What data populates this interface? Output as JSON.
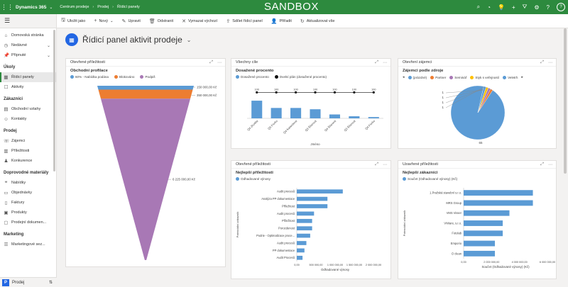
{
  "top": {
    "brand": "Dynamics 365",
    "area": "Centrum prodeje",
    "crumbs": [
      "Prodej",
      "Řídicí panely"
    ],
    "sandbox": "SANDBOX",
    "avatar_initial": "?"
  },
  "commands": [
    {
      "icon": "save-icon",
      "glyph": "🖫",
      "label": "Uložit jako",
      "chev": ""
    },
    {
      "icon": "plus-icon",
      "glyph": "+",
      "label": "Nový",
      "chev": "⌄"
    },
    {
      "icon": "pencil-icon",
      "glyph": "✎",
      "label": "Upravit",
      "chev": ""
    },
    {
      "icon": "trash-icon",
      "glyph": "🗑",
      "label": "Odstranit",
      "chev": ""
    },
    {
      "icon": "close-icon",
      "glyph": "✕",
      "label": "Vymazat výchozí",
      "chev": ""
    },
    {
      "icon": "share-icon",
      "glyph": "⇪",
      "label": "Sdílet řídicí panel",
      "chev": ""
    },
    {
      "icon": "assign-icon",
      "glyph": "👤",
      "label": "Přiřadit",
      "chev": ""
    },
    {
      "icon": "refresh-icon",
      "glyph": "↻",
      "label": "Aktualizovat vše",
      "chev": ""
    }
  ],
  "sidebar": {
    "top_items": [
      {
        "name": "home",
        "glyph": "⌂",
        "label": "Domovská stránka",
        "exp": ""
      },
      {
        "name": "recent",
        "glyph": "◷",
        "label": "Nedávné",
        "exp": "⌄"
      },
      {
        "name": "pinned",
        "glyph": "📌",
        "label": "Připnuté",
        "exp": "⌄"
      }
    ],
    "groups": [
      {
        "name": "ukoly",
        "title": "Úkoly",
        "items": [
          {
            "name": "dashboards",
            "glyph": "▦",
            "label": "Řídicí panely",
            "active": true
          },
          {
            "name": "activities",
            "glyph": "☐",
            "label": "Aktivity",
            "active": false
          }
        ]
      },
      {
        "name": "zakaznici",
        "title": "Zákazníci",
        "items": [
          {
            "name": "accounts",
            "glyph": "▤",
            "label": "Obchodní vztahy",
            "active": false
          },
          {
            "name": "contacts",
            "glyph": "☺",
            "label": "Kontakty",
            "active": false
          }
        ]
      },
      {
        "name": "prodej",
        "title": "Prodej",
        "items": [
          {
            "name": "leads",
            "glyph": "☏",
            "label": "Zájemci",
            "active": false
          },
          {
            "name": "opportunities",
            "glyph": "▥",
            "label": "Příležitosti",
            "active": false
          },
          {
            "name": "competitors",
            "glyph": "♟",
            "label": "Konkurence",
            "active": false
          }
        ]
      },
      {
        "name": "doprovodne",
        "title": "Doprovodné materiály",
        "items": [
          {
            "name": "quotes",
            "glyph": "❝",
            "label": "Nabídky",
            "active": false
          },
          {
            "name": "orders",
            "glyph": "▭",
            "label": "Objednávky",
            "active": false
          },
          {
            "name": "invoices",
            "glyph": "▯",
            "label": "Faktury",
            "active": false
          },
          {
            "name": "products",
            "glyph": "▣",
            "label": "Produkty",
            "active": false
          },
          {
            "name": "salesdocs",
            "glyph": "▢",
            "label": "Prodejní dokumen...",
            "active": false
          }
        ]
      },
      {
        "name": "marketing",
        "title": "Marketing",
        "items": [
          {
            "name": "marketinglists",
            "glyph": "☰",
            "label": "Marketingové sez...",
            "active": false
          }
        ]
      }
    ],
    "area_switcher": {
      "letter": "P",
      "label": "Prodej",
      "chev": "⇅"
    }
  },
  "page": {
    "title": "Řídicí panel aktivit prodeje"
  },
  "panels": {
    "p1": {
      "header": "Otevřené příležitosti",
      "title": "Obchodní profilace",
      "legend": [
        {
          "label": "60% - Nabídka podána",
          "color": "#5b9bd5"
        },
        {
          "label": "Blokováno",
          "color": "#ed7d31"
        },
        {
          "label": "Podpiš",
          "color": "#a878b5"
        }
      ]
    },
    "p2": {
      "header": "Všechny cíle",
      "title": "Dosažené procento",
      "legend": [
        {
          "label": "Dosažené procento",
          "color": "#5b9bd5"
        },
        {
          "label": "Dvelsí plán (dosažené procento)",
          "color": "#111111"
        }
      ]
    },
    "p3": {
      "header": "Otevření zájemci",
      "title": "Zájemci podle zdroje",
      "legend": [
        {
          "label": "(prázdné)",
          "color": "#5b9bd5"
        },
        {
          "label": "Partner",
          "color": "#ed7d31"
        },
        {
          "label": "Seminář",
          "color": "#a878b5"
        },
        {
          "label": "Styk s veřejností",
          "color": "#ffc000"
        },
        {
          "label": "Veletrh",
          "color": "#5b9bd5"
        }
      ]
    },
    "p4": {
      "header": "Otevřené příležitosti",
      "title": "Nejlepší příležitosti",
      "legend": [
        {
          "label": "Odhadované výnosy",
          "color": "#5b9bd5"
        }
      ]
    },
    "p5": {
      "header": "Uzavřené příležitosti",
      "title": "Nejlepší zákazníci",
      "legend": [
        {
          "label": "Součet (Odhadované výnosy) (Kč)",
          "color": "#5b9bd5"
        }
      ]
    }
  },
  "chart_data": [
    {
      "type": "funnel",
      "title": "Obchodní profilace",
      "categories": [
        "60% - Nabídka podána",
        "Blokováno",
        "Podpiš"
      ],
      "values": [
        150000,
        350000,
        6225000
      ],
      "labels": [
        "150 000,00 Kč",
        "350 000,00 Kč",
        "6 225 000,00 Kč"
      ],
      "colors": [
        "#5b9bd5",
        "#ed7d31",
        "#a878b5"
      ]
    },
    {
      "type": "bar",
      "title": "Dosažené procento",
      "xlabel": "Jméno",
      "categories": [
        "Q4 Zhodila",
        "Q3 Fiorko",
        "Q4 Kalandova",
        "Q3 Šilarová",
        "Q4 Šilarová",
        "Q3 Šilarová",
        "Q4 Fiorko"
      ],
      "series": [
        {
          "name": "Dosažené procento",
          "type": "bar",
          "values": [
            68,
            40,
            40,
            35,
            15,
            8,
            5
          ],
          "color": "#5b9bd5"
        },
        {
          "name": "Dvelsí plán (dosažené procento)",
          "type": "line",
          "values": [
            100,
            100,
            100,
            100,
            100,
            100,
            100
          ],
          "color": "#111111"
        }
      ],
      "point_labels": [
        "100",
        "100",
        "100",
        "100",
        "100",
        "100",
        "100"
      ],
      "ylim": [
        0,
        120
      ]
    },
    {
      "type": "pie",
      "title": "Zájemci podle zdroje",
      "categories": [
        "(prázdné)",
        "Partner",
        "Seminář",
        "Styk s veřejností",
        "Veletrh"
      ],
      "values": [
        65,
        1,
        1,
        1,
        1
      ],
      "colors": [
        "#5b9bd5",
        "#ed7d31",
        "#a878b5",
        "#ffc000",
        "#5b9bd5"
      ],
      "labels": [
        "65",
        "1",
        "1",
        "1",
        "1"
      ]
    },
    {
      "type": "bar",
      "orientation": "horizontal",
      "title": "Nejlepší příležitosti",
      "xlabel": "Odhadované výnosy",
      "ylabel": "Potenciální zákazník",
      "categories": [
        "Audit procesů",
        "Analýza PP dokumentace",
        "Příležitost",
        "Audit procesů",
        "Příležitost",
        "Porozdenost",
        "Podrie - Optimalizace proce...",
        "Audit procesů",
        "PP dokumentace",
        "Audit Procesů"
      ],
      "values": [
        1200000,
        800000,
        800000,
        450000,
        400000,
        400000,
        350000,
        250000,
        200000,
        150000
      ],
      "xticks": [
        "0,00",
        "500 000,00",
        "1 000 000,00",
        "1 500 000,00",
        "2 000 000,00"
      ],
      "xlim": [
        0,
        2000000
      ]
    },
    {
      "type": "bar",
      "orientation": "horizontal",
      "title": "Nejlepší zákazníci",
      "xlabel": "Součet (Odhadované výnosy) (Kč)",
      "ylabel": "Potenciální zákazník",
      "categories": [
        "1.Pražská stavební s.r.o.",
        "MRS Group",
        "VMS Visser",
        "VIWare, s.r.o.",
        "Fotolab",
        "Emporio",
        "O clean"
      ],
      "values": [
        6200000,
        6200000,
        4100000,
        3500000,
        3500000,
        2800000,
        2800000
      ],
      "xticks": [
        "0,00",
        "2 000 000,00",
        "4 000 000,00",
        "6 000 000,00"
      ],
      "xlim": [
        0,
        7500000
      ]
    }
  ]
}
